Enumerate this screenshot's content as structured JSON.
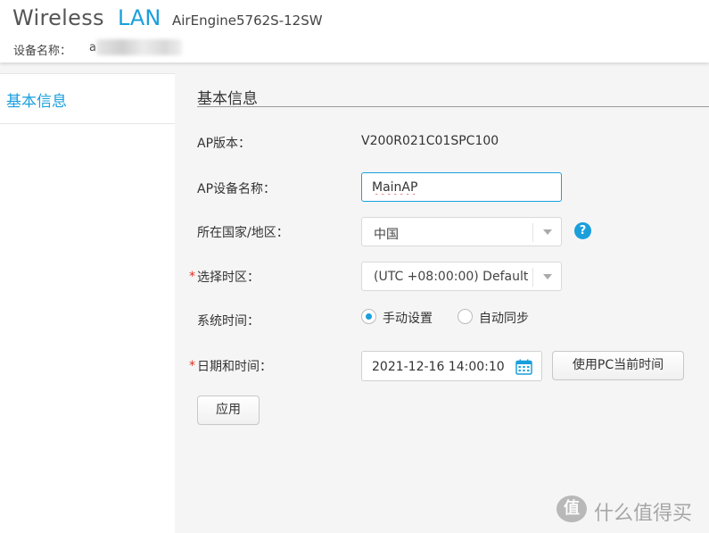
{
  "header": {
    "brand_wireless": "Wireless",
    "brand_lan": "LAN",
    "model": "AirEngine5762S-12SW",
    "device_name_label": "设备名称：",
    "device_name_value": "a"
  },
  "sidebar": {
    "items": [
      {
        "label": "基本信息"
      }
    ]
  },
  "main": {
    "section_title": "基本信息",
    "fields": {
      "ap_version": {
        "label": "AP版本：",
        "value": "V200R021C01SPC100"
      },
      "ap_device_name": {
        "label": "AP设备名称：",
        "value": "MainAP"
      },
      "country": {
        "label": "所在国家/地区：",
        "value": "中国"
      },
      "timezone": {
        "label": "选择时区：",
        "value": "(UTC +08:00:00) Default",
        "required_mark": "*"
      },
      "system_time": {
        "label": "系统时间：",
        "options": [
          {
            "label": "手动设置",
            "checked": true
          },
          {
            "label": "自动同步",
            "checked": false
          }
        ]
      },
      "datetime": {
        "label": "日期和时间：",
        "value": "2021-12-16 14:00:10",
        "required_mark": "*"
      }
    },
    "help_icon_glyph": "?",
    "use_pc_time_label": "使用PC当前时间",
    "apply_label": "应用"
  },
  "watermark": {
    "badge": "值",
    "text": "什么值得买"
  },
  "colors": {
    "accent": "#1a9fdc",
    "required": "#e0301e",
    "background": "#f5f5f5"
  },
  "icons": {
    "help": "question-circle-icon",
    "calendar": "calendar-icon",
    "dropdown": "chevron-down-icon"
  }
}
